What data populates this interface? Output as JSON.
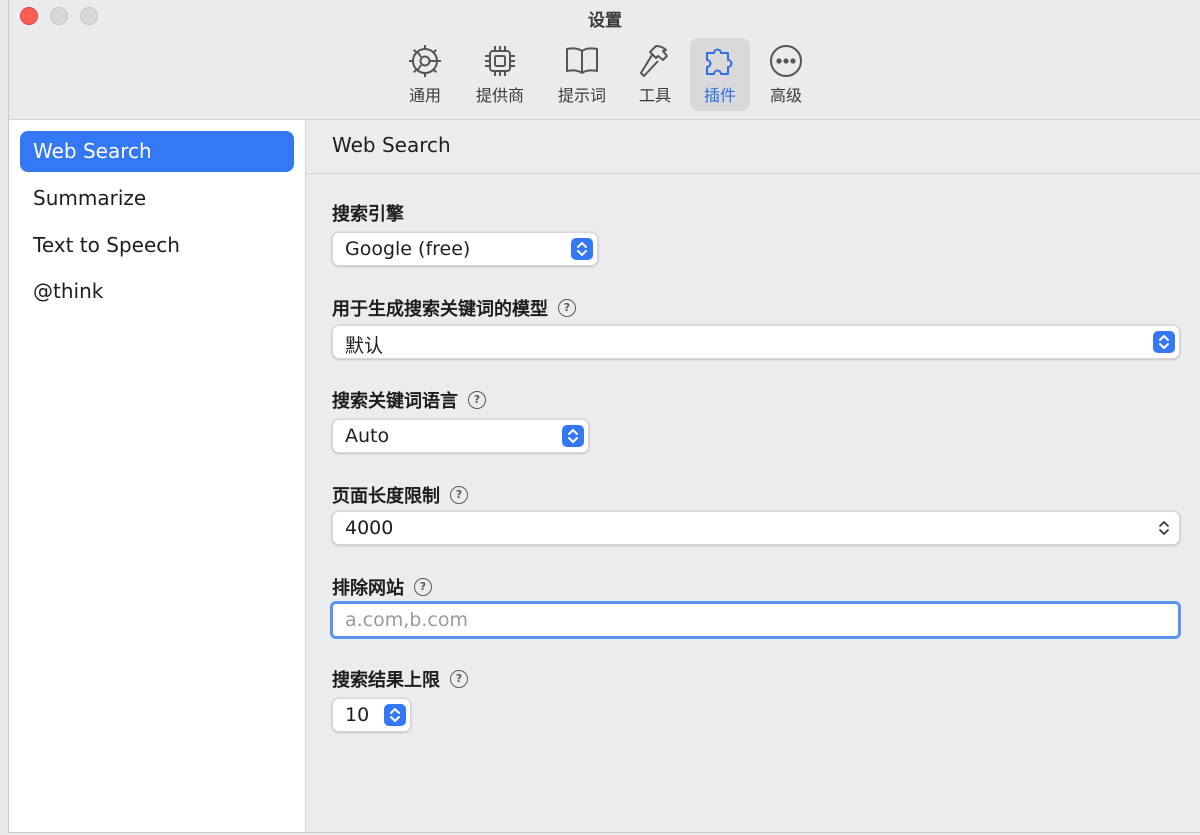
{
  "window": {
    "title": "设置"
  },
  "toolbar": {
    "items": [
      {
        "label": "通用",
        "icon": "gear-icon"
      },
      {
        "label": "提供商",
        "icon": "chip-icon"
      },
      {
        "label": "提示词",
        "icon": "book-icon"
      },
      {
        "label": "工具",
        "icon": "hammer-icon"
      },
      {
        "label": "插件",
        "icon": "puzzle-icon",
        "active": true
      },
      {
        "label": "高级",
        "icon": "more-icon"
      }
    ],
    "accent": "#2f6fe0"
  },
  "sidebar": {
    "items": [
      {
        "label": "Web Search",
        "selected": true
      },
      {
        "label": "Summarize"
      },
      {
        "label": "Text to Speech"
      },
      {
        "label": "@think"
      }
    ],
    "selection_color": "#3478f6"
  },
  "main": {
    "title": "Web Search",
    "fields": {
      "search_engine": {
        "label": "搜索引擎",
        "value": "Google (free)"
      },
      "keyword_model": {
        "label": "用于生成搜索关键词的模型",
        "value": "默认"
      },
      "keyword_language": {
        "label": "搜索关键词语言",
        "value": "Auto"
      },
      "page_length_limit": {
        "label": "页面长度限制",
        "value": "4000"
      },
      "exclude_sites": {
        "label": "排除网站",
        "value": "",
        "placeholder": "a.com,b.com"
      },
      "result_limit": {
        "label": "搜索结果上限",
        "value": "10"
      }
    },
    "help_glyph": "?"
  }
}
